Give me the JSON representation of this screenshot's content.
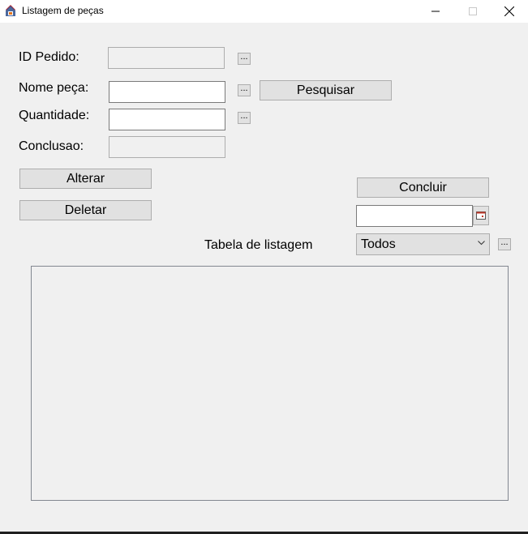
{
  "window": {
    "title": "Listagem de peças",
    "app_icon": "java-cup-icon",
    "controls": [
      "minimize-icon",
      "maximize-icon",
      "close-icon"
    ]
  },
  "form": {
    "id_pedido_label": "ID Pedido:",
    "id_pedido_value": "",
    "nome_peca_label": "Nome peça:",
    "nome_peca_value": "",
    "quantidade_label": "Quantidade:",
    "quantidade_value": "",
    "conclusao_label": "Conclusao:",
    "conclusao_value": "",
    "browse_label": "..."
  },
  "buttons": {
    "pesquisar": "Pesquisar",
    "alterar": "Alterar",
    "deletar": "Deletar",
    "concluir": "Concluir",
    "filter_browse": "..."
  },
  "date_picker": {
    "value": "",
    "icon": "calendar-icon"
  },
  "listing": {
    "title": "Tabela de listagem",
    "filter_selected": "Todos"
  }
}
